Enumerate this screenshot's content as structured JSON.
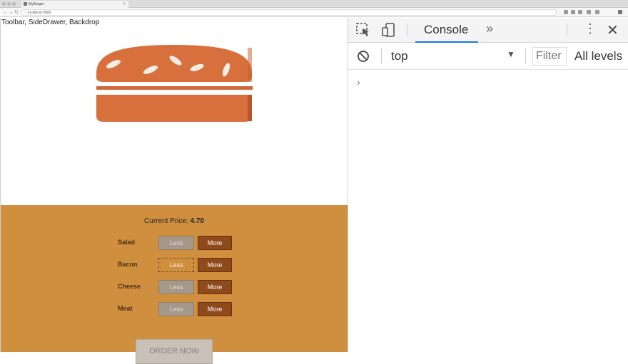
{
  "browser": {
    "tab_title": "MyBurger",
    "url": "localhost:3000"
  },
  "app": {
    "note": "Toolbar, SideDrawer, Backdrop",
    "price_label": "Current Price: ",
    "price_value": "4.70",
    "ingredients": [
      {
        "label": "Salad",
        "less": "Less",
        "more": "More"
      },
      {
        "label": "Bacon",
        "less": "Less",
        "more": "More"
      },
      {
        "label": "Cheese",
        "less": "Less",
        "more": "More"
      },
      {
        "label": "Meat",
        "less": "Less",
        "more": "More"
      }
    ],
    "order_label": "ORDER NOW",
    "colors": {
      "bun": "#d4693a",
      "controls_bg": "#cf8f3f",
      "more_btn": "#8f4a1c"
    }
  },
  "devtools": {
    "tab_console": "Console",
    "context": "top",
    "filter_placeholder": "Filter",
    "levels": "All levels"
  }
}
